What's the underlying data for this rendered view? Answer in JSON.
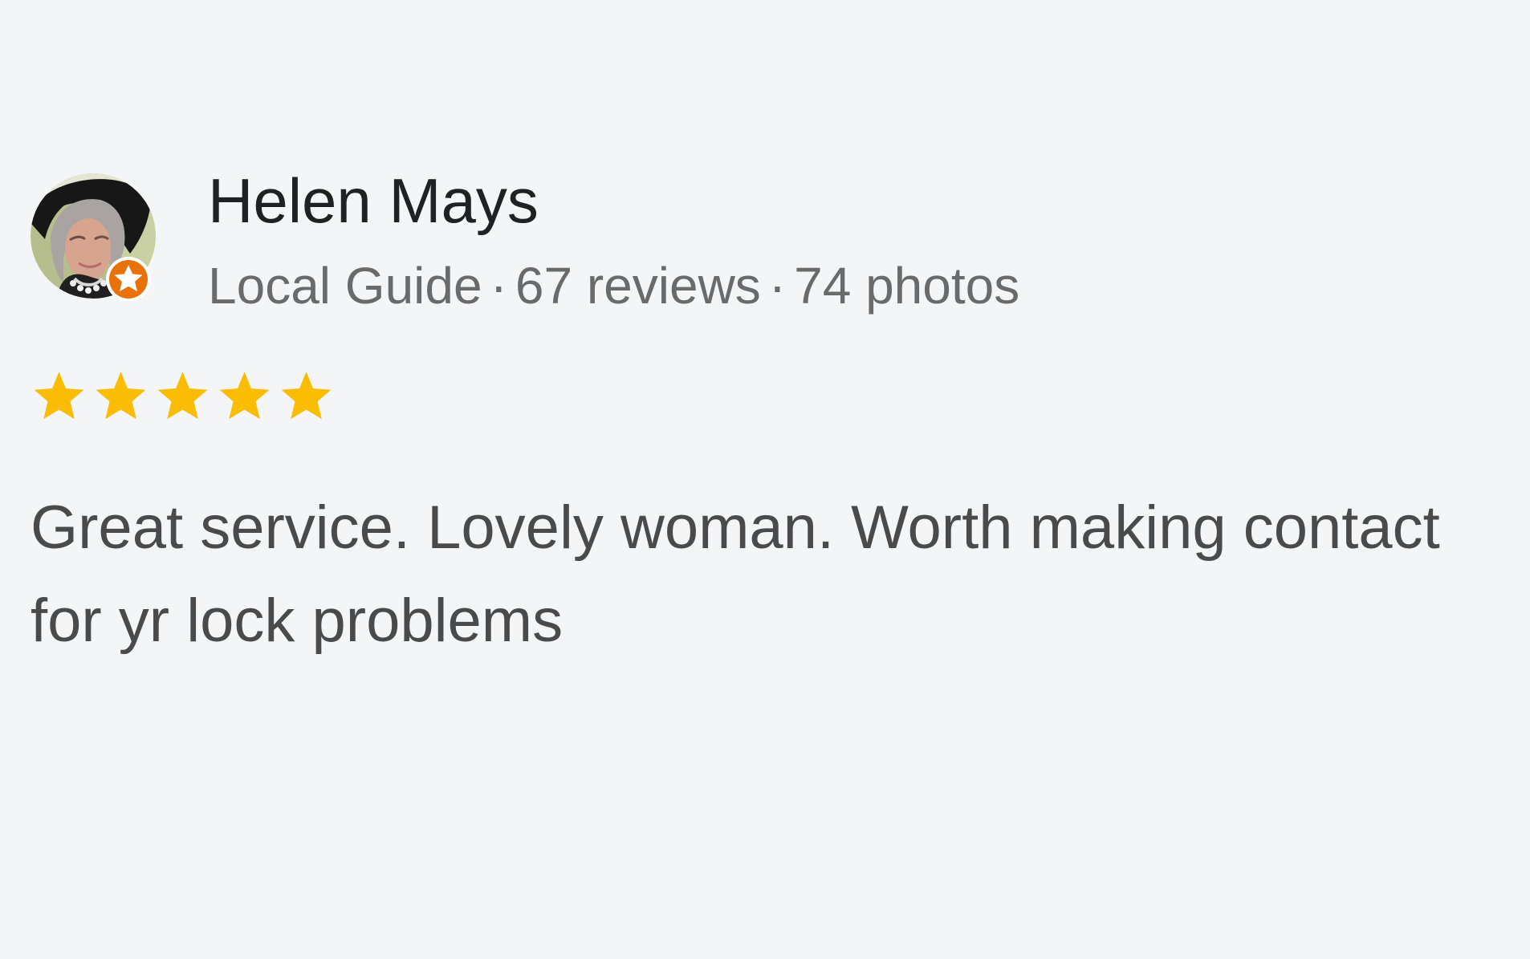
{
  "reviewer": {
    "name": "Helen Mays",
    "badge": "Local Guide",
    "separator": "·",
    "reviews": "67 reviews",
    "photos": "74 photos"
  },
  "rating": {
    "stars": 5,
    "max": 5,
    "color": "#fbbc04"
  },
  "review": {
    "text": "Great service. Lovely woman. Worth making contact for yr lock problems"
  },
  "icons": {
    "avatar": "reviewer-photo",
    "badge": "local-guide-star-icon",
    "rating": "star-icon"
  },
  "colors": {
    "background": "#f4f5f7",
    "name": "#202124",
    "meta": "#6a6a6a",
    "text": "#4a4a4a",
    "badge": "#e8710a"
  }
}
